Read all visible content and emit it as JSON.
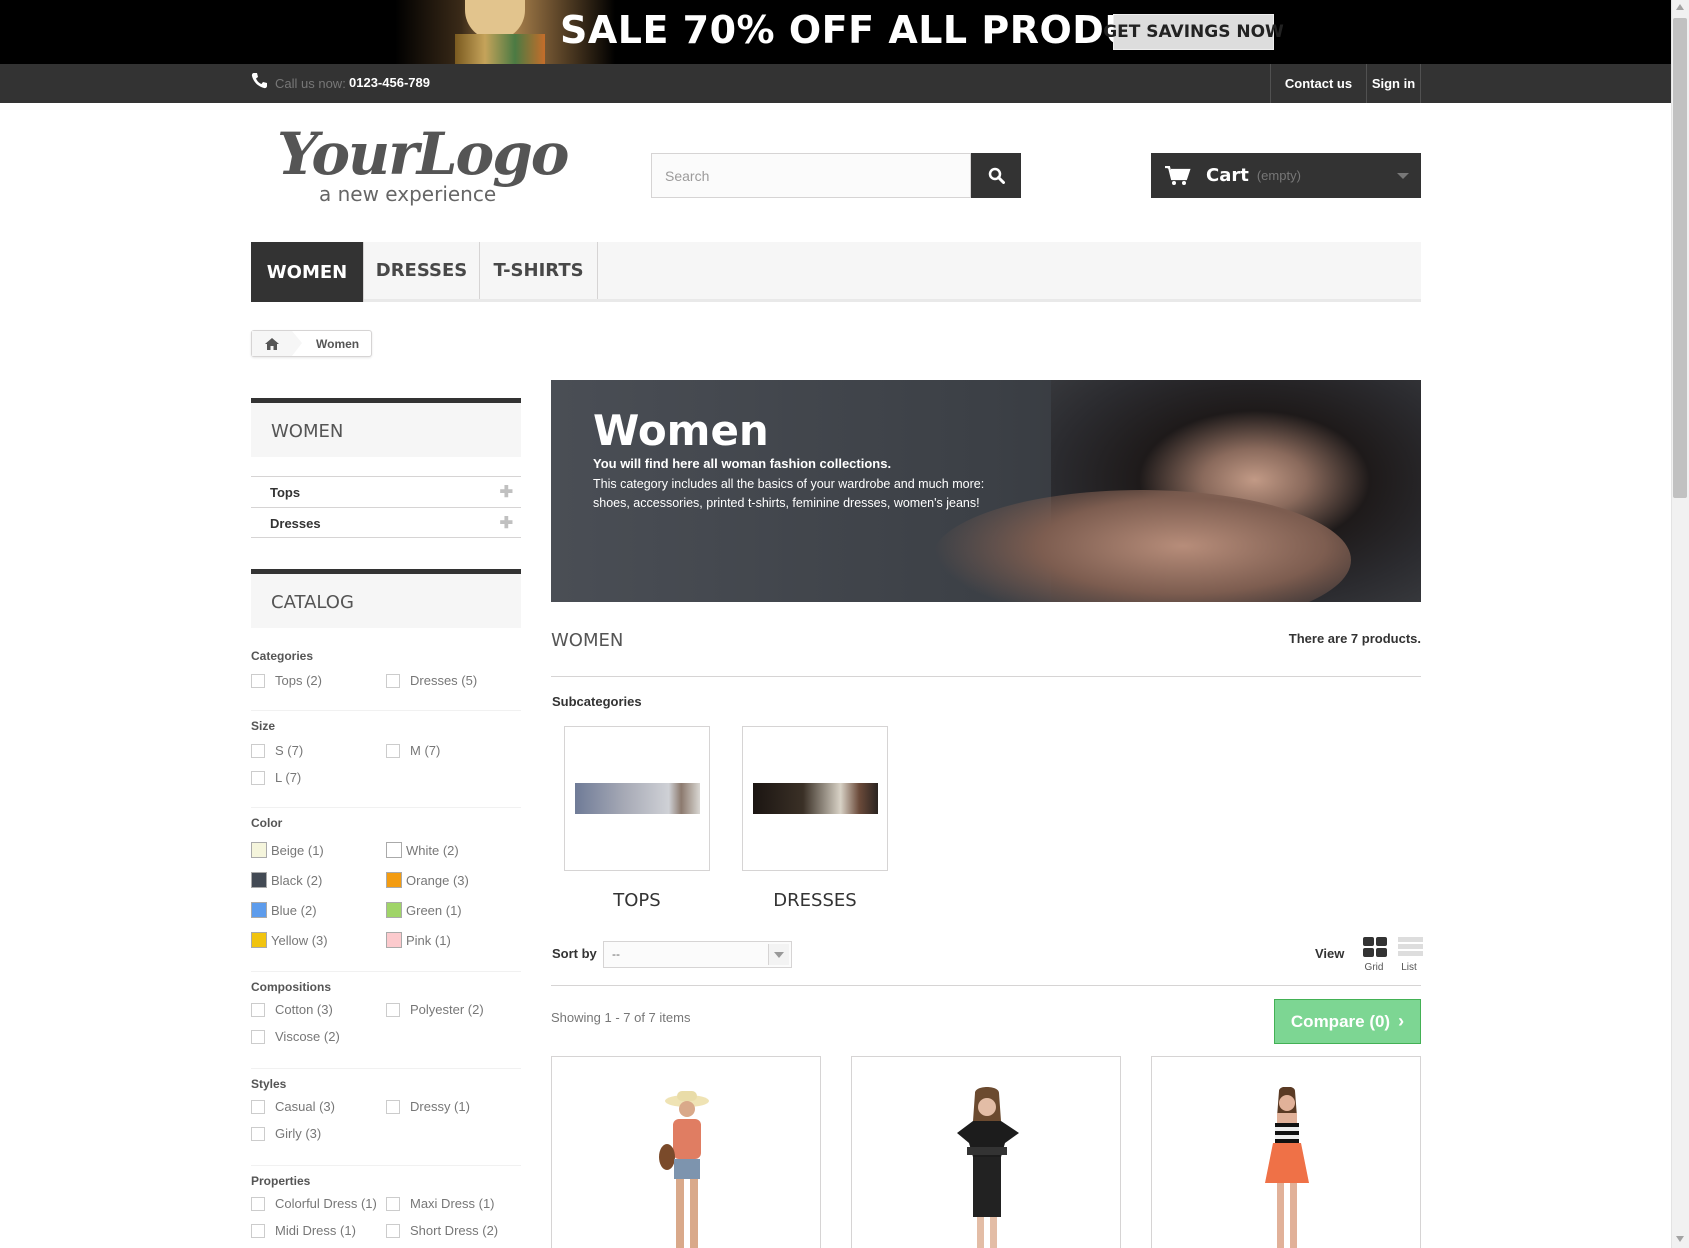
{
  "banner": {
    "title": "SALE 70% OFF ALL PRODUCTS",
    "button_label": "GET SAVINGS NOW"
  },
  "topbar": {
    "call_label": "Call us now:",
    "phone": "0123-456-789",
    "contact_label": "Contact us",
    "signin_label": "Sign in"
  },
  "header": {
    "logo_text": "YourLogo",
    "logo_tagline": "a new experience",
    "search_placeholder": "Search",
    "cart_label": "Cart",
    "cart_status": "(empty)"
  },
  "menu": {
    "items": [
      {
        "label": "WOMEN",
        "active": true
      },
      {
        "label": "DRESSES",
        "active": false
      },
      {
        "label": "T-SHIRTS",
        "active": false
      }
    ]
  },
  "breadcrumb": {
    "current": "Women"
  },
  "sidebar": {
    "category_title": "WOMEN",
    "categories": [
      {
        "label": "Tops"
      },
      {
        "label": "Dresses"
      }
    ],
    "catalog_title": "CATALOG",
    "filters": {
      "categories": {
        "heading": "Categories",
        "options": [
          "Tops (2)",
          "Dresses (5)"
        ]
      },
      "size": {
        "heading": "Size",
        "options": [
          "S (7)",
          "M (7)",
          "L (7)"
        ]
      },
      "color": {
        "heading": "Color",
        "options": [
          {
            "label": "Beige (1)",
            "swatch": "#f5f5dc"
          },
          {
            "label": "White (2)",
            "swatch": "#ffffff"
          },
          {
            "label": "Black (2)",
            "swatch": "#434a54"
          },
          {
            "label": "Orange (3)",
            "swatch": "#f39c11"
          },
          {
            "label": "Blue (2)",
            "swatch": "#5d9cec"
          },
          {
            "label": "Green (1)",
            "swatch": "#a0d468"
          },
          {
            "label": "Yellow (3)",
            "swatch": "#f1c40f"
          },
          {
            "label": "Pink (1)",
            "swatch": "#fccacd"
          }
        ]
      },
      "compositions": {
        "heading": "Compositions",
        "options": [
          "Cotton (3)",
          "Polyester (2)",
          "Viscose (2)"
        ]
      },
      "styles": {
        "heading": "Styles",
        "options": [
          "Casual (3)",
          "Dressy (1)",
          "Girly (3)"
        ]
      },
      "properties": {
        "heading": "Properties",
        "options": [
          "Colorful Dress (1)",
          "Maxi Dress (1)",
          "Midi Dress (1)",
          "Short Dress (2)"
        ]
      }
    }
  },
  "category": {
    "hero_title": "Women",
    "hero_subtitle": "You will find here all woman fashion collections.",
    "hero_description": "This category includes all the basics of your wardrobe and much more: shoes, accessories, printed t-shirts, feminine dresses, women's jeans!",
    "name": "WOMEN",
    "product_count": "There are 7 products.",
    "subcategories_label": "Subcategories",
    "subcategories": [
      {
        "name": "TOPS"
      },
      {
        "name": "DRESSES"
      }
    ]
  },
  "toolbar": {
    "sort_label": "Sort by",
    "sort_value": "--",
    "view_label": "View",
    "grid_label": "Grid",
    "list_label": "List",
    "showing": "Showing 1 - 7 of 7 items",
    "compare_label": "Compare (0)"
  },
  "colors": {
    "dark": "#333333",
    "compare_green": "#7dd693",
    "border": "#d6d4d4"
  }
}
